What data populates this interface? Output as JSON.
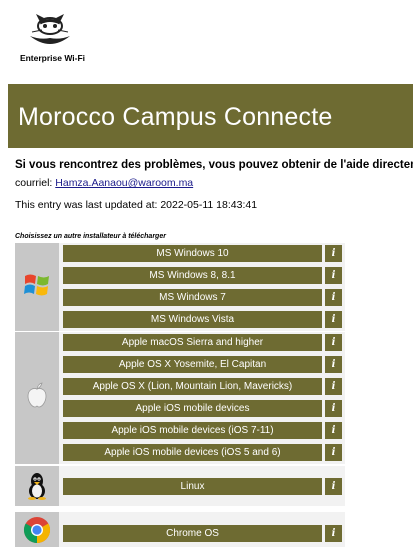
{
  "header": {
    "logo_icon": "cat-mascot-icon",
    "logo_text": "Enterprise Wi-Fi",
    "banner_title": "Morocco Campus Connecte",
    "banner_color": "#6e6b32"
  },
  "info": {
    "help_text": "Si vous rencontrez des problèmes, vous pouvez obtenir de l'aide directement",
    "email_label": "courriel: ",
    "email": "Hamza.Aanaou@waroom.ma",
    "last_updated": "This entry was last updated at: 2022-05-11 18:43:41"
  },
  "installers": {
    "heading": "Choisissez un autre installateur à télécharger",
    "info_glyph": "i",
    "groups": [
      {
        "icon": "windows-icon",
        "items": [
          "MS Windows 10",
          "MS Windows 8, 8.1",
          "MS Windows 7",
          "MS Windows Vista"
        ]
      },
      {
        "icon": "apple-icon",
        "items": [
          "Apple macOS Sierra and higher",
          "Apple OS X Yosemite, El Capitan",
          "Apple OS X (Lion, Mountain Lion, Mavericks)",
          "Apple iOS mobile devices",
          "Apple iOS mobile devices (iOS 7-11)",
          "Apple iOS mobile devices (iOS 5 and 6)"
        ]
      },
      {
        "icon": "linux-tux-icon",
        "items": [
          "Linux"
        ]
      },
      {
        "icon": "chrome-icon",
        "items": [
          "Chrome OS"
        ]
      }
    ]
  }
}
